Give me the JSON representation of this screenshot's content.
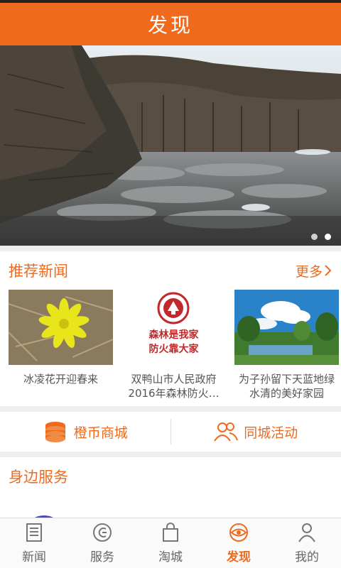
{
  "header": {
    "title": "发现"
  },
  "banner": {
    "slides": 2,
    "active_slide": 2
  },
  "news": {
    "title": "推荐新闻",
    "more": "更多",
    "items": [
      {
        "caption": "冰凌花开迎春来"
      },
      {
        "caption": "双鸭山市人民政府2016年森林防火…",
        "logo_text_1": "森林是我家",
        "logo_text_2": "防火靠大家"
      },
      {
        "caption": "为子孙留下天蓝地绿水清的美好家园"
      }
    ]
  },
  "shortcuts": {
    "mall": "橙币商城",
    "activity": "同城活动"
  },
  "services": {
    "title": "身边服务"
  },
  "tabs": [
    {
      "label": "新闻",
      "icon": "newspaper-icon"
    },
    {
      "label": "服务",
      "icon": "service-icon"
    },
    {
      "label": "淘城",
      "icon": "shopping-bag-icon"
    },
    {
      "label": "发现",
      "icon": "discover-eye-icon"
    },
    {
      "label": "我的",
      "icon": "person-icon"
    }
  ],
  "colors": {
    "accent": "#ef6a1c",
    "tab_inactive": "#666666"
  }
}
